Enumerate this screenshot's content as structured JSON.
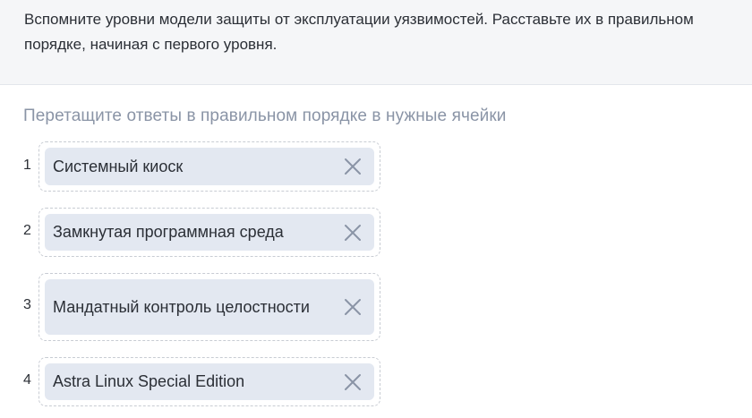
{
  "question": {
    "text": "Вспомните уровни модели защиты от эксплуатации уязвимостей. Расставьте их в правильном порядке, начиная с первого уровня."
  },
  "instruction": "Перетащите ответы в правильном порядке в нужные ячейки",
  "slots": [
    {
      "index": "1",
      "answer": "Системный киоск",
      "remove_icon": "close-icon"
    },
    {
      "index": "2",
      "answer": "Замкнутая программная среда",
      "remove_icon": "close-icon"
    },
    {
      "index": "3",
      "answer": "Мандатный контроль целостности",
      "remove_icon": "close-icon"
    },
    {
      "index": "4",
      "answer": "Astra Linux Special Edition",
      "remove_icon": "close-icon"
    }
  ],
  "colors": {
    "question_bg": "#f5f6f8",
    "chip_bg": "#e3e8f1",
    "instruction_text": "#8a94a6",
    "icon": "#8a94a6"
  }
}
